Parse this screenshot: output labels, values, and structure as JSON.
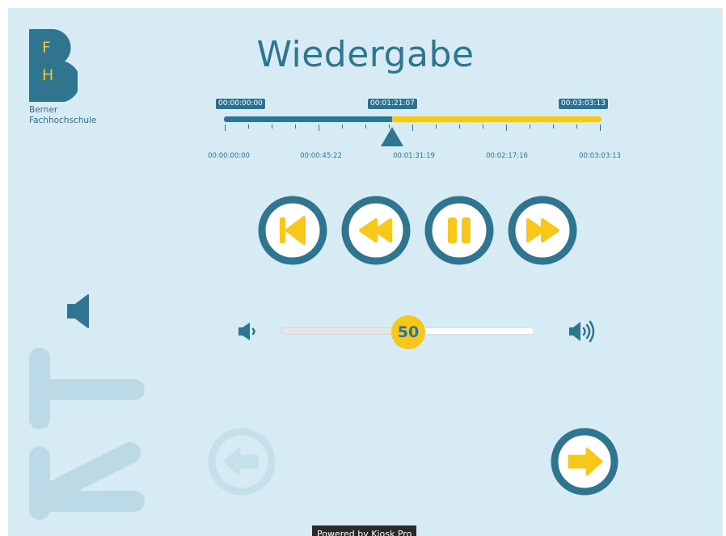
{
  "logo": {
    "letter_top": "F",
    "letter_bottom": "H",
    "line1": "Berner",
    "line2": "Fachhochschule"
  },
  "title": "Wiedergabe",
  "timeline": {
    "start_tag": "00:00:00:00",
    "current_tag": "00:01:21:07",
    "end_tag": "00:03:03:13",
    "progress_fraction": 0.445,
    "tick_labels": [
      "00:00:00:00",
      "00:00:45:22",
      "00:01:31:19",
      "00:02:17:16",
      "00:03:03:13"
    ]
  },
  "controls": [
    {
      "name": "skip-to-start-button",
      "icon": "skip-back-icon"
    },
    {
      "name": "rewind-button",
      "icon": "rewind-icon"
    },
    {
      "name": "pause-button",
      "icon": "pause-icon"
    },
    {
      "name": "fast-forward-button",
      "icon": "fast-forward-icon"
    }
  ],
  "volume": {
    "value": "50",
    "level_fraction": 0.5,
    "min_icon": "volume-low-icon",
    "max_icon": "volume-high-icon",
    "side_icon": "speaker-icon"
  },
  "navigation": {
    "back_icon": "arrow-left-icon",
    "next_icon": "arrow-right-icon"
  },
  "colors": {
    "background": "#d6ebf3",
    "primary": "#2f7590",
    "accent": "#f7c81a"
  },
  "footer": {
    "powered_by": "Powered by Kiosk Pro"
  }
}
